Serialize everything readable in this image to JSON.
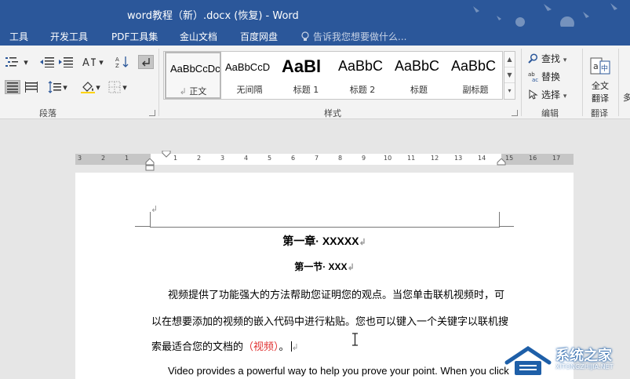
{
  "window": {
    "title": "word教程（新）.docx (恢复) - Word"
  },
  "menu": {
    "tabs": [
      "工具",
      "开发工具",
      "PDF工具集",
      "金山文档",
      "百度网盘"
    ],
    "tell_me": "告诉我您想要做什么..."
  },
  "ribbon": {
    "groups": {
      "paragraph": "段落",
      "styles": "样式",
      "editing": "编辑",
      "translate": "翻译"
    },
    "styles": [
      {
        "preview": "AaBbCcDc",
        "name": "正文",
        "mark": "↲",
        "selected": true
      },
      {
        "preview": "AaBbCcD",
        "name": "无间隔",
        "selected": false
      },
      {
        "preview": "AaBl",
        "name": "标题 1",
        "selected": false
      },
      {
        "preview": "AaBbC",
        "name": "标题 2",
        "selected": false
      },
      {
        "preview": "AaBbC",
        "name": "标题",
        "selected": false
      },
      {
        "preview": "AaBbC",
        "name": "副标题",
        "selected": false
      }
    ],
    "editing": {
      "find": "查找",
      "replace": "替换",
      "select": "选择"
    },
    "translate_button": {
      "line1": "全文",
      "line2": "翻译"
    },
    "overflow_char": "多"
  },
  "ruler": {
    "left_numbers": [
      "3",
      "2",
      "1"
    ],
    "right_numbers": [
      "1",
      "2",
      "3",
      "4",
      "5",
      "6",
      "7",
      "8",
      "9",
      "10",
      "11",
      "12",
      "13",
      "14",
      "15",
      "16",
      "17"
    ]
  },
  "document": {
    "chapter": "第一章· XXXXX",
    "section": "第一节· XXX",
    "para1_line1": "视频提供了功能强大的方法帮助您证明您的观点。当您单击联机视频时，可",
    "para1_line2": "以在想要添加的视频的嵌入代码中进行粘贴。您也可以键入一个关键字以联机搜",
    "para1_line3": "索最适合您的文档的",
    "para1_red": "（视频）",
    "para1_end": "。",
    "para2_line1": "Video provides a powerful way to help you prove your point. When you click",
    "para_mark": "↲"
  },
  "watermark": {
    "title": "系统之家",
    "url": "XITONGZHIJIA.NET"
  },
  "colors": {
    "word_blue": "#2b579a",
    "red_text": "#e03030"
  }
}
